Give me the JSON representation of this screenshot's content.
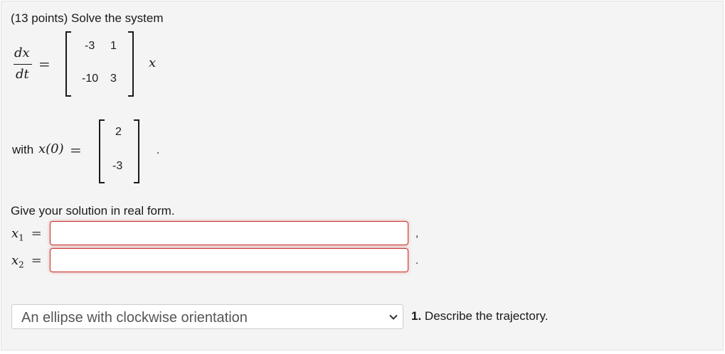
{
  "problem": {
    "title": "(13 points) Solve the system",
    "derivative_numerator": "dx",
    "derivative_denominator": "dt",
    "equals": "=",
    "matrix": [
      [
        "-3",
        "1"
      ],
      [
        "-10",
        "3"
      ]
    ],
    "state_var": "x",
    "initial_label": "with",
    "initial_expr": "x(0)",
    "initial_vector": [
      "2",
      "-3"
    ],
    "period": "."
  },
  "answer": {
    "instruction": "Give your solution in real form.",
    "x1_label": "x",
    "x1_sub": "1",
    "x2_label": "x",
    "x2_sub": "2",
    "x1_value": "",
    "x2_value": "",
    "x1_separator": ",",
    "x2_separator": "."
  },
  "trajectory": {
    "selected": "An ellipse with clockwise orientation",
    "question_number": "1.",
    "question_text": "Describe the trajectory."
  },
  "colors": {
    "card_background": "#f4f4f4",
    "input_error_border": "#c9302c"
  }
}
